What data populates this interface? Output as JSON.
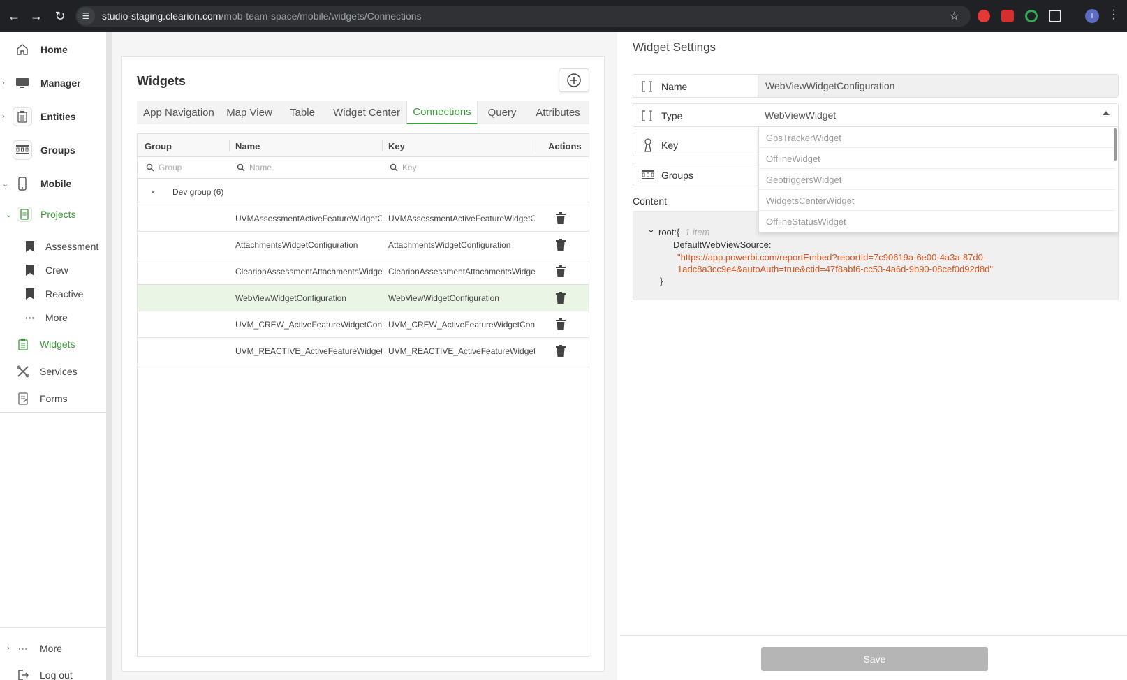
{
  "browser": {
    "url_host": "studio-staging.clearion.com",
    "url_path": "/mob-team-space/mobile/widgets/Connections",
    "profile_initial": "I"
  },
  "sidebar": {
    "items": [
      {
        "label": "Home",
        "icon": "home-icon"
      },
      {
        "label": "Manager",
        "icon": "monitor-icon"
      },
      {
        "label": "Entities",
        "icon": "clipboard-icon"
      },
      {
        "label": "Groups",
        "icon": "groups-icon"
      },
      {
        "label": "Mobile",
        "icon": "phone-icon"
      }
    ],
    "projects_label": "Projects",
    "project_items": [
      "Assessment",
      "Crew",
      "Reactive",
      "More"
    ],
    "widgets_label": "Widgets",
    "services_label": "Services",
    "forms_label": "Forms",
    "bottom_more": "More",
    "logout": "Log out"
  },
  "widgets": {
    "title": "Widgets",
    "tabs": [
      "App Navigation",
      "Map View",
      "Table",
      "Widget Center",
      "Connections",
      "Query",
      "Attributes"
    ],
    "active_tab": "Connections",
    "columns": {
      "group": "Group",
      "name": "Name",
      "key": "Key",
      "actions": "Actions"
    },
    "filters": {
      "group": "Group",
      "name": "Name",
      "key": "Key"
    },
    "group_label": "Dev group (6)",
    "rows": [
      {
        "name": "UVMAssessmentActiveFeatureWidgetConfiguration",
        "key": "UVMAssessmentActiveFeatureWidgetConfiguration"
      },
      {
        "name": "AttachmentsWidgetConfiguration",
        "key": "AttachmentsWidgetConfiguration"
      },
      {
        "name": "ClearionAssessmentAttachmentsWidget",
        "key": "ClearionAssessmentAttachmentsWidget"
      },
      {
        "name": "WebViewWidgetConfiguration",
        "key": "WebViewWidgetConfiguration"
      },
      {
        "name": "UVM_CREW_ActiveFeatureWidgetConfiguration",
        "key": "UVM_CREW_ActiveFeatureWidgetConfiguration"
      },
      {
        "name": "UVM_REACTIVE_ActiveFeatureWidgetConfiguration",
        "key": "UVM_REACTIVE_ActiveFeatureWidgetConfiguration"
      }
    ]
  },
  "settings": {
    "title": "Widget Settings",
    "name_label": "Name",
    "name_value": "WebViewWidgetConfiguration",
    "type_label": "Type",
    "type_value": "WebViewWidget",
    "key_label": "Key",
    "groups_label": "Groups",
    "content_label": "Content",
    "type_options": [
      "GpsTrackerWidget",
      "OfflineWidget",
      "GeotriggersWidget",
      "WidgetsCenterWidget",
      "OfflineStatusWidget"
    ],
    "json": {
      "root": "root:{",
      "count": "1 item",
      "key": "DefaultWebViewSource:",
      "value_line1": "\"https://app.powerbi.com/reportEmbed?reportId=7c90619a-6e00-4a3a-87d0-",
      "value_line2": "1adc8a3cc9e4&autoAuth=true&ctid=47f8abf6-cc53-4a6d-9b90-08cef0d92d8d\"",
      "close": "}"
    },
    "save_label": "Save"
  }
}
